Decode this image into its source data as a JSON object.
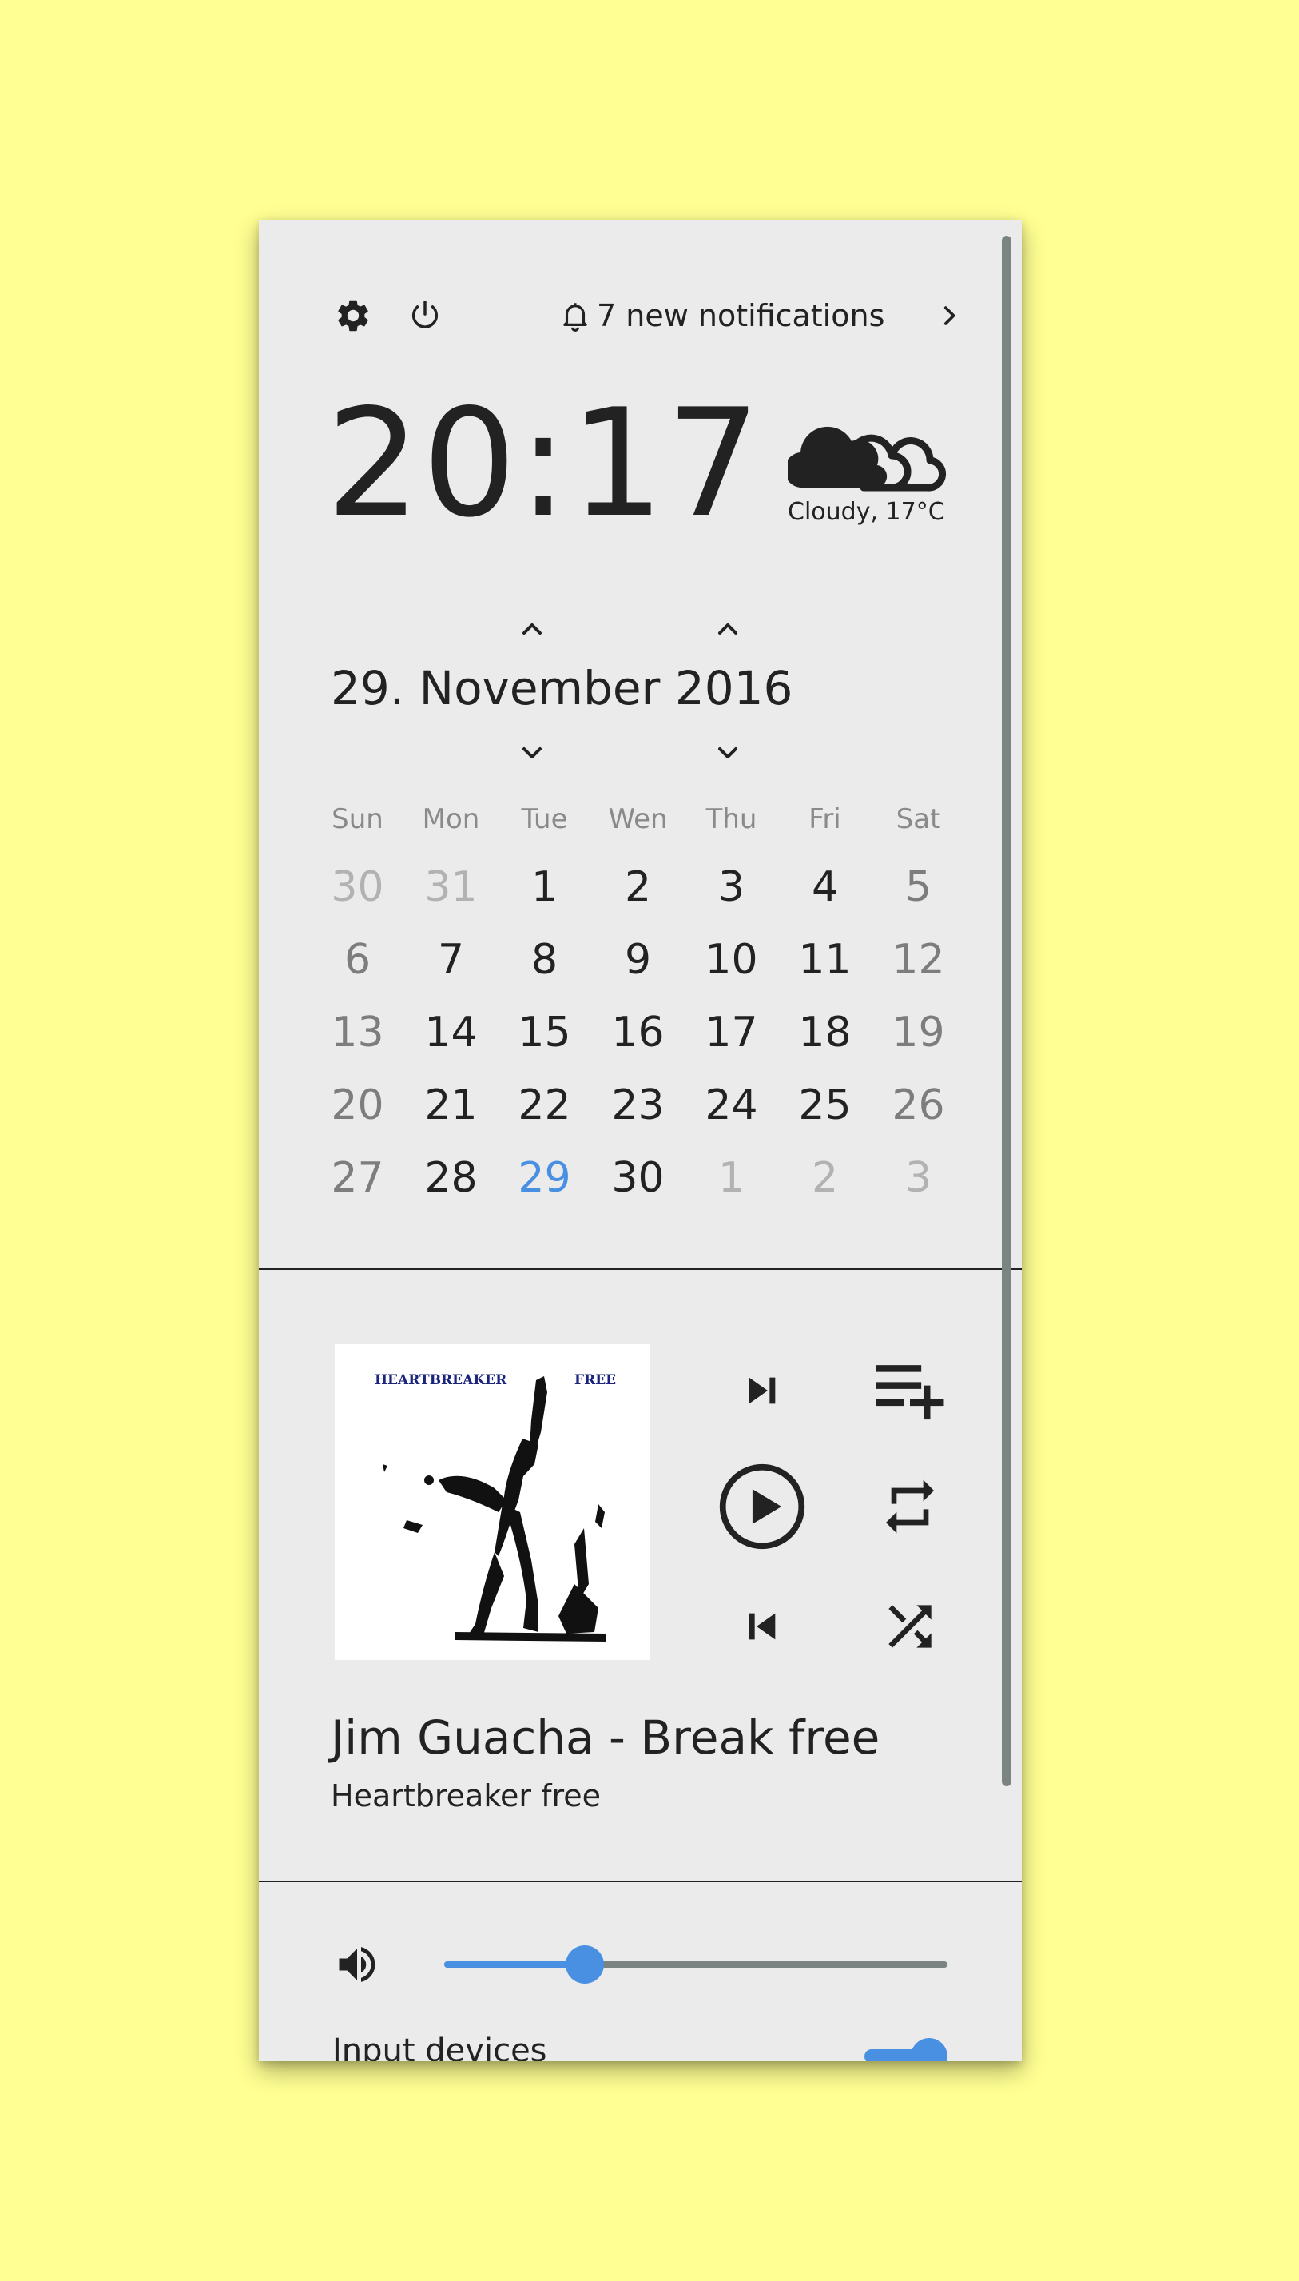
{
  "header": {
    "notifications_label": "7 new notifications",
    "icons": [
      "gear-icon",
      "power-icon",
      "bell-icon",
      "chevron-right-icon"
    ]
  },
  "clock": {
    "time": "20:17",
    "weather_text": "Cloudy, 17°C",
    "weather_icon": "cloud-icon"
  },
  "calendar": {
    "date_title": "29. November 2016",
    "weekdays": [
      "Sun",
      "Mon",
      "Tue",
      "Wen",
      "Thu",
      "Fri",
      "Sat"
    ],
    "weeks": [
      [
        {
          "d": "30",
          "k": "other"
        },
        {
          "d": "31",
          "k": "other"
        },
        {
          "d": "1",
          "k": "normal"
        },
        {
          "d": "2",
          "k": "normal"
        },
        {
          "d": "3",
          "k": "normal"
        },
        {
          "d": "4",
          "k": "normal"
        },
        {
          "d": "5",
          "k": "weekend"
        }
      ],
      [
        {
          "d": "6",
          "k": "weekend"
        },
        {
          "d": "7",
          "k": "normal"
        },
        {
          "d": "8",
          "k": "normal"
        },
        {
          "d": "9",
          "k": "normal"
        },
        {
          "d": "10",
          "k": "normal"
        },
        {
          "d": "11",
          "k": "normal"
        },
        {
          "d": "12",
          "k": "weekend"
        }
      ],
      [
        {
          "d": "13",
          "k": "weekend"
        },
        {
          "d": "14",
          "k": "normal"
        },
        {
          "d": "15",
          "k": "normal"
        },
        {
          "d": "16",
          "k": "normal"
        },
        {
          "d": "17",
          "k": "normal"
        },
        {
          "d": "18",
          "k": "normal"
        },
        {
          "d": "19",
          "k": "weekend"
        }
      ],
      [
        {
          "d": "20",
          "k": "weekend"
        },
        {
          "d": "21",
          "k": "normal"
        },
        {
          "d": "22",
          "k": "normal"
        },
        {
          "d": "23",
          "k": "normal"
        },
        {
          "d": "24",
          "k": "normal"
        },
        {
          "d": "25",
          "k": "normal"
        },
        {
          "d": "26",
          "k": "weekend"
        }
      ],
      [
        {
          "d": "27",
          "k": "weekend"
        },
        {
          "d": "28",
          "k": "normal"
        },
        {
          "d": "29",
          "k": "today"
        },
        {
          "d": "30",
          "k": "normal"
        },
        {
          "d": "1",
          "k": "other"
        },
        {
          "d": "2",
          "k": "other"
        },
        {
          "d": "3",
          "k": "other"
        }
      ]
    ]
  },
  "media": {
    "album_art": {
      "title_left": "HEARTBREAKER",
      "title_right": "FREE"
    },
    "song_title": "Jim Guacha - Break free",
    "album_name": "Heartbreaker free",
    "controls": [
      "skip-next-icon",
      "playlist-add-icon",
      "play-icon",
      "repeat-icon",
      "skip-previous-icon",
      "shuffle-icon"
    ]
  },
  "volume": {
    "level": 0.28,
    "icon": "volume-icon"
  },
  "input_devices": {
    "label": "Input devices",
    "enabled": true
  },
  "colors": {
    "background": "#ffff93",
    "panel": "#ebebeb",
    "accent": "#4a90e2",
    "text": "#222222",
    "scrollbar": "#7c8483"
  }
}
